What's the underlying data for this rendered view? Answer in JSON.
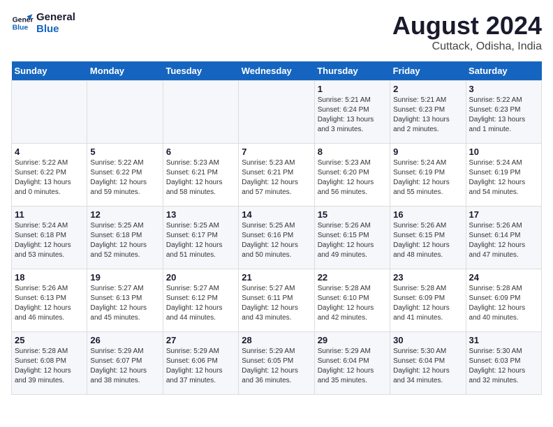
{
  "header": {
    "logo_line1": "General",
    "logo_line2": "Blue",
    "main_title": "August 2024",
    "subtitle": "Cuttack, Odisha, India"
  },
  "calendar": {
    "days_of_week": [
      "Sunday",
      "Monday",
      "Tuesday",
      "Wednesday",
      "Thursday",
      "Friday",
      "Saturday"
    ],
    "weeks": [
      [
        {
          "day": "",
          "info": ""
        },
        {
          "day": "",
          "info": ""
        },
        {
          "day": "",
          "info": ""
        },
        {
          "day": "",
          "info": ""
        },
        {
          "day": "1",
          "info": "Sunrise: 5:21 AM\nSunset: 6:24 PM\nDaylight: 13 hours\nand 3 minutes."
        },
        {
          "day": "2",
          "info": "Sunrise: 5:21 AM\nSunset: 6:23 PM\nDaylight: 13 hours\nand 2 minutes."
        },
        {
          "day": "3",
          "info": "Sunrise: 5:22 AM\nSunset: 6:23 PM\nDaylight: 13 hours\nand 1 minute."
        }
      ],
      [
        {
          "day": "4",
          "info": "Sunrise: 5:22 AM\nSunset: 6:22 PM\nDaylight: 13 hours\nand 0 minutes."
        },
        {
          "day": "5",
          "info": "Sunrise: 5:22 AM\nSunset: 6:22 PM\nDaylight: 12 hours\nand 59 minutes."
        },
        {
          "day": "6",
          "info": "Sunrise: 5:23 AM\nSunset: 6:21 PM\nDaylight: 12 hours\nand 58 minutes."
        },
        {
          "day": "7",
          "info": "Sunrise: 5:23 AM\nSunset: 6:21 PM\nDaylight: 12 hours\nand 57 minutes."
        },
        {
          "day": "8",
          "info": "Sunrise: 5:23 AM\nSunset: 6:20 PM\nDaylight: 12 hours\nand 56 minutes."
        },
        {
          "day": "9",
          "info": "Sunrise: 5:24 AM\nSunset: 6:19 PM\nDaylight: 12 hours\nand 55 minutes."
        },
        {
          "day": "10",
          "info": "Sunrise: 5:24 AM\nSunset: 6:19 PM\nDaylight: 12 hours\nand 54 minutes."
        }
      ],
      [
        {
          "day": "11",
          "info": "Sunrise: 5:24 AM\nSunset: 6:18 PM\nDaylight: 12 hours\nand 53 minutes."
        },
        {
          "day": "12",
          "info": "Sunrise: 5:25 AM\nSunset: 6:18 PM\nDaylight: 12 hours\nand 52 minutes."
        },
        {
          "day": "13",
          "info": "Sunrise: 5:25 AM\nSunset: 6:17 PM\nDaylight: 12 hours\nand 51 minutes."
        },
        {
          "day": "14",
          "info": "Sunrise: 5:25 AM\nSunset: 6:16 PM\nDaylight: 12 hours\nand 50 minutes."
        },
        {
          "day": "15",
          "info": "Sunrise: 5:26 AM\nSunset: 6:15 PM\nDaylight: 12 hours\nand 49 minutes."
        },
        {
          "day": "16",
          "info": "Sunrise: 5:26 AM\nSunset: 6:15 PM\nDaylight: 12 hours\nand 48 minutes."
        },
        {
          "day": "17",
          "info": "Sunrise: 5:26 AM\nSunset: 6:14 PM\nDaylight: 12 hours\nand 47 minutes."
        }
      ],
      [
        {
          "day": "18",
          "info": "Sunrise: 5:26 AM\nSunset: 6:13 PM\nDaylight: 12 hours\nand 46 minutes."
        },
        {
          "day": "19",
          "info": "Sunrise: 5:27 AM\nSunset: 6:13 PM\nDaylight: 12 hours\nand 45 minutes."
        },
        {
          "day": "20",
          "info": "Sunrise: 5:27 AM\nSunset: 6:12 PM\nDaylight: 12 hours\nand 44 minutes."
        },
        {
          "day": "21",
          "info": "Sunrise: 5:27 AM\nSunset: 6:11 PM\nDaylight: 12 hours\nand 43 minutes."
        },
        {
          "day": "22",
          "info": "Sunrise: 5:28 AM\nSunset: 6:10 PM\nDaylight: 12 hours\nand 42 minutes."
        },
        {
          "day": "23",
          "info": "Sunrise: 5:28 AM\nSunset: 6:09 PM\nDaylight: 12 hours\nand 41 minutes."
        },
        {
          "day": "24",
          "info": "Sunrise: 5:28 AM\nSunset: 6:09 PM\nDaylight: 12 hours\nand 40 minutes."
        }
      ],
      [
        {
          "day": "25",
          "info": "Sunrise: 5:28 AM\nSunset: 6:08 PM\nDaylight: 12 hours\nand 39 minutes."
        },
        {
          "day": "26",
          "info": "Sunrise: 5:29 AM\nSunset: 6:07 PM\nDaylight: 12 hours\nand 38 minutes."
        },
        {
          "day": "27",
          "info": "Sunrise: 5:29 AM\nSunset: 6:06 PM\nDaylight: 12 hours\nand 37 minutes."
        },
        {
          "day": "28",
          "info": "Sunrise: 5:29 AM\nSunset: 6:05 PM\nDaylight: 12 hours\nand 36 minutes."
        },
        {
          "day": "29",
          "info": "Sunrise: 5:29 AM\nSunset: 6:04 PM\nDaylight: 12 hours\nand 35 minutes."
        },
        {
          "day": "30",
          "info": "Sunrise: 5:30 AM\nSunset: 6:04 PM\nDaylight: 12 hours\nand 34 minutes."
        },
        {
          "day": "31",
          "info": "Sunrise: 5:30 AM\nSunset: 6:03 PM\nDaylight: 12 hours\nand 32 minutes."
        }
      ]
    ]
  }
}
